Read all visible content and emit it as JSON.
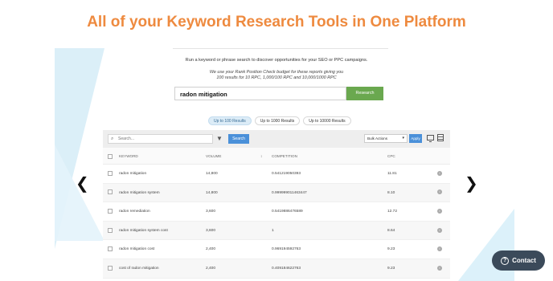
{
  "page": {
    "title": "All of your Keyword Research Tools in One Platform",
    "intro": "Run a keyword or phrase search to discover opportunities for your SEO or PPC campaigns.",
    "budget_line1": "We use your Rank Position Check budget for these reports giving you",
    "budget_line2": "100 results for 10 RPC, 1,000/100 RPC and 10,000/1000 RPC"
  },
  "search": {
    "value": "radon mitigation",
    "button": "Research"
  },
  "result_options": [
    {
      "label": "Up to 100 Results",
      "active": true
    },
    {
      "label": "Up to 1000 Results",
      "active": false
    },
    {
      "label": "Up to 10000 Results",
      "active": false
    }
  ],
  "toolbar": {
    "search_placeholder": "Search...",
    "search_button": "Search",
    "bulk_actions": "Bulk Actions",
    "apply_button": "Apply"
  },
  "table": {
    "headers": {
      "keyword": "KEYWORD",
      "volume": "VOLUME",
      "competition": "COMPETITION",
      "cpc": "CPC"
    },
    "rows": [
      {
        "keyword": "radon mitigation",
        "volume": "14,800",
        "competition": "0.541219050393",
        "cpc": "11.81"
      },
      {
        "keyword": "radon mitigation system",
        "volume": "14,800",
        "competition": "0.999999011463447",
        "cpc": "8.10"
      },
      {
        "keyword": "radon remediation",
        "volume": "3,600",
        "competition": "0.5419886476589",
        "cpc": "12.72"
      },
      {
        "keyword": "radon mitigation system cost",
        "volume": "3,600",
        "competition": "1",
        "cpc": "8.64"
      },
      {
        "keyword": "radon mitigation cost",
        "volume": "2,400",
        "competition": "0.969194592763",
        "cpc": "9.23"
      },
      {
        "keyword": "cost of radon mitigation",
        "volume": "2,400",
        "competition": "0.409184622763",
        "cpc": "9.23"
      }
    ]
  },
  "carousel": {
    "prev": "❮",
    "next": "❯"
  },
  "contact": {
    "label": "Contact",
    "icon": "?"
  },
  "colors": {
    "title": "#ee8a3f",
    "research_button": "#6aa84f",
    "accent_blue": "#4a90d9",
    "contact_bg": "#3b4a5a"
  }
}
